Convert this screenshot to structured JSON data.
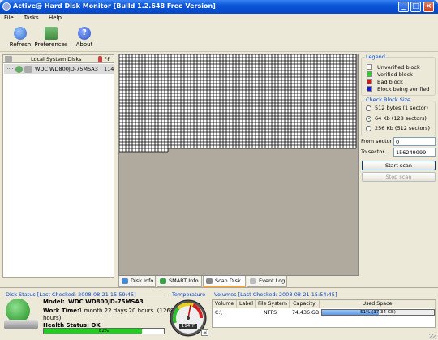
{
  "window": {
    "title": "Active@ Hard Disk Monitor [Build 1.2.648 Free Version]",
    "app_icon": "hdd-monitor-icon"
  },
  "menu": [
    "File",
    "Tasks",
    "Help"
  ],
  "toolbar": [
    {
      "label": "Refresh",
      "icon": "refresh-icon",
      "color": "#2a66c8"
    },
    {
      "label": "Preferences",
      "icon": "preferences-icon",
      "color": "#3d8a3d"
    },
    {
      "label": "About",
      "icon": "about-icon",
      "color": "#2a52c8"
    }
  ],
  "disks_panel": {
    "header": "Local System Disks",
    "temp_unit": "°F",
    "disks": [
      {
        "name": "WDC WD800JD-75MSA3",
        "temp": "114"
      }
    ]
  },
  "surface": {
    "verified_fraction": 0.43,
    "colors": {
      "verified": "#ffffff",
      "background": "#b0aa9e"
    }
  },
  "legend": {
    "title": "Legend",
    "items": [
      {
        "label": "Unverified block",
        "color": "#ffffff"
      },
      {
        "label": "Verified block",
        "color": "#2ad02a"
      },
      {
        "label": "Bad block",
        "color": "#d01818"
      },
      {
        "label": "Block being verified",
        "color": "#1a1ad0"
      }
    ]
  },
  "block_size": {
    "title": "Check Block Size",
    "options": [
      "512 bytes (1 sector)",
      "64 Kb (128 sectors)",
      "256 Kb (512 sectors)"
    ],
    "selected": 1
  },
  "range": {
    "from_label": "From sector",
    "from_value": "0",
    "to_label": "To sector",
    "to_value": "156249999"
  },
  "buttons": {
    "start": "Start scan",
    "stop": "Stop scan"
  },
  "tabs": [
    "Disk Info",
    "SMART Info",
    "Scan Disk",
    "Event Log"
  ],
  "active_tab": 2,
  "status": {
    "disk_status_title": "Disk Status [Last Checked: 2008-08-21 15:59:45]",
    "model_label": "Model:",
    "model_value": "WDC WD800JD-75MSA3",
    "work_time_label": "Work Time:",
    "work_time_value": "1 month 22 days 20 hours. (1268",
    "work_time_value2": "hours)",
    "health_label": "Health Status: OK",
    "health_value": "82%",
    "health_fraction": 0.82,
    "temp_title": "Temperature",
    "gauge_value": "114°F",
    "volumes_title": "Volumes [Last Checked: 2008-08-21 15:54:45]",
    "volume_headers": [
      "Volume",
      "Label",
      "File System",
      "Capacity",
      "Used Space"
    ],
    "volumes": [
      {
        "volume": "C:\\",
        "label": "",
        "fs": "NTFS",
        "capacity": "74.436 GB",
        "used": "51% (37.34 GB)",
        "used_fraction": 0.51
      }
    ]
  }
}
